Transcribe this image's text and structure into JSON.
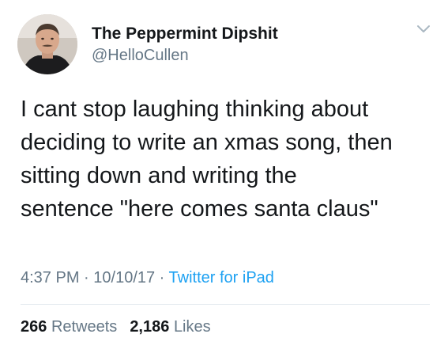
{
  "author": {
    "display_name": "The Peppermint Dipshit",
    "handle": "@HelloCullen"
  },
  "tweet": {
    "text": "I cant stop laughing thinking about\ndeciding to write an xmas song, then\nsitting down and writing the\nsentence \"here comes santa claus\""
  },
  "meta": {
    "time": "4:37 PM",
    "sep1": " · ",
    "date": "10/10/17",
    "sep2": " · ",
    "source": "Twitter for iPad"
  },
  "stats": {
    "retweets_count": "266",
    "retweets_label": "Retweets",
    "likes_count": "2,186",
    "likes_label": "Likes"
  },
  "icons": {
    "menu": "chevron-down-icon"
  },
  "colors": {
    "text": "#14171a",
    "secondary": "#657786",
    "link": "#1da1f2",
    "divider": "#e1e8ed"
  }
}
